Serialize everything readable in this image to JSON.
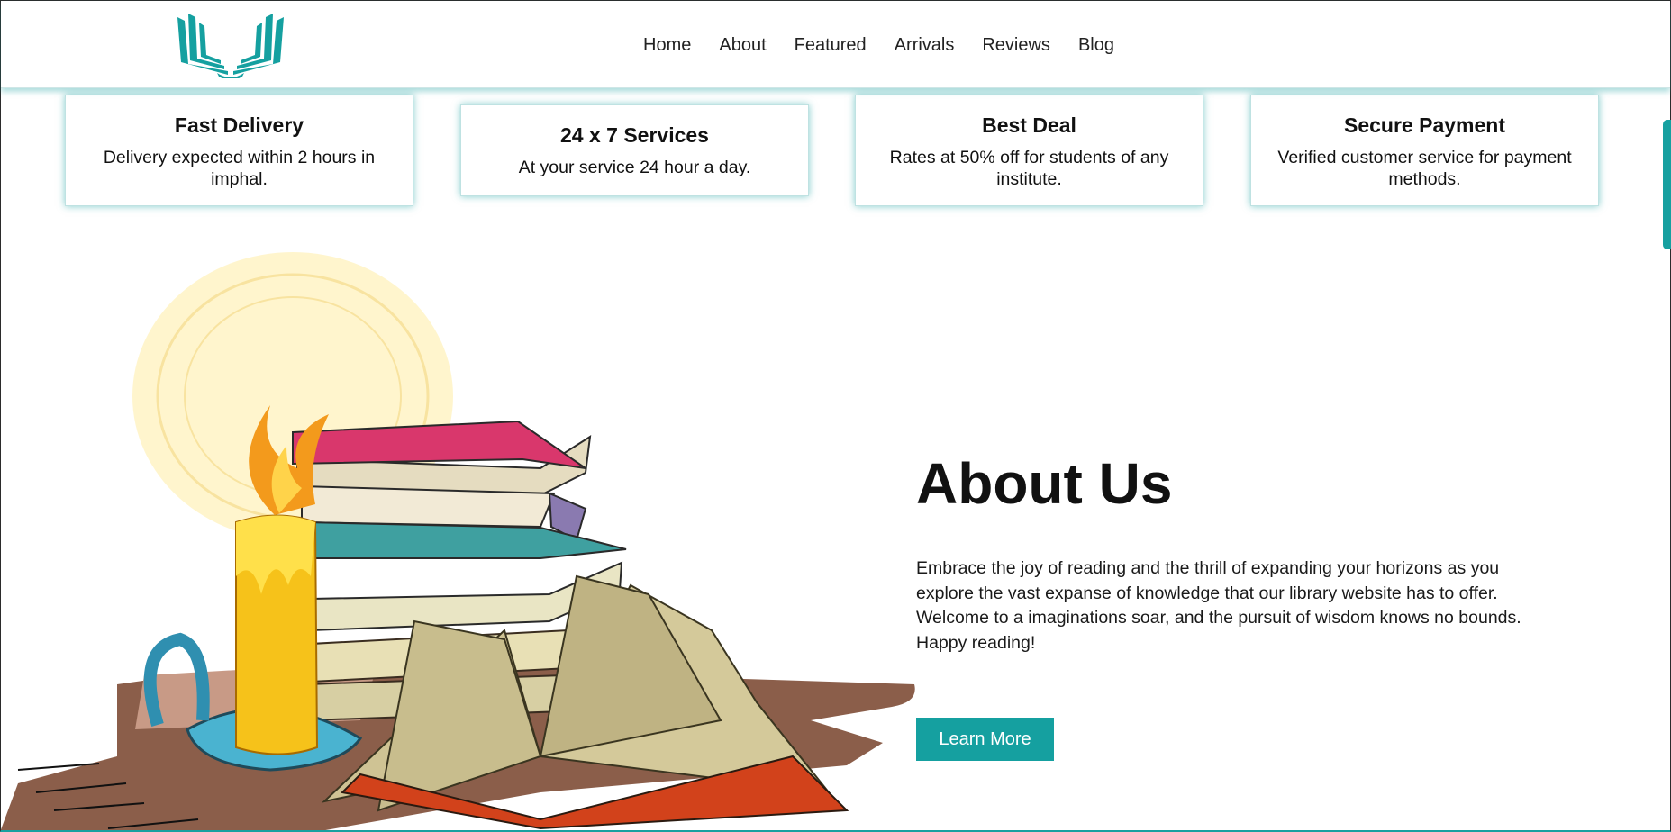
{
  "nav": {
    "items": [
      {
        "label": "Home"
      },
      {
        "label": "About"
      },
      {
        "label": "Featured"
      },
      {
        "label": "Arrivals"
      },
      {
        "label": "Reviews"
      },
      {
        "label": "Blog"
      }
    ]
  },
  "features": [
    {
      "title": "Fast Delivery",
      "text": "Delivery expected within 2 hours in imphal."
    },
    {
      "title": "24 x 7 Services",
      "text": "At your service 24 hour a day."
    },
    {
      "title": "Best Deal",
      "text": "Rates at 50% off for students of any institute."
    },
    {
      "title": "Secure Payment",
      "text": "Verified customer service for payment methods."
    }
  ],
  "about": {
    "title": "About Us",
    "text": "Embrace the joy of reading and the thrill of expanding your horizons as you explore the vast expanse of knowledge that our library website has to offer. Welcome to a imaginations soar, and the pursuit of wisdom knows no bounds. Happy reading!",
    "button_label": "Learn More"
  },
  "colors": {
    "accent": "#15a0a0",
    "text": "#111111"
  },
  "icons": {
    "logo": "open-book-logo-icon"
  }
}
